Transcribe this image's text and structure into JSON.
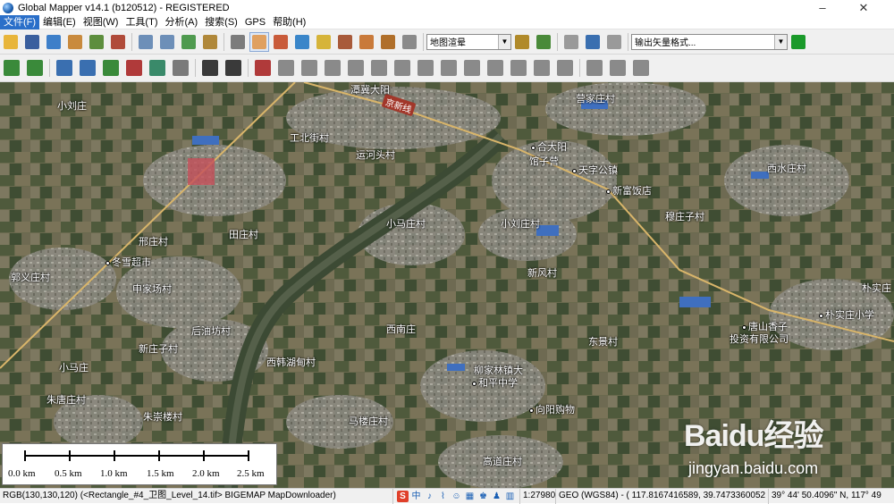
{
  "app": {
    "title": "Global Mapper v14.1 (b120512) - REGISTERED",
    "icon": "globe-icon"
  },
  "window_controls": {
    "minimize": "–",
    "close": "✕"
  },
  "menu": [
    {
      "label": "文件(F)",
      "active": true
    },
    {
      "label": "编辑(E)"
    },
    {
      "label": "视图(W)"
    },
    {
      "label": "工具(T)"
    },
    {
      "label": "分析(A)"
    },
    {
      "label": "搜索(S)"
    },
    {
      "label": "GPS"
    },
    {
      "label": "帮助(H)"
    }
  ],
  "toolbar1": {
    "buttons_a": [
      {
        "name": "open-folder-icon",
        "color": "#e8b53a"
      },
      {
        "name": "save-icon",
        "color": "#3a5f9e"
      },
      {
        "name": "globe-data-icon",
        "color": "#3d7fc9"
      },
      {
        "name": "image-icon",
        "color": "#c98a3d"
      },
      {
        "name": "layers-icon",
        "color": "#5d8e3d"
      },
      {
        "name": "config-tools-icon",
        "color": "#b04b3a"
      }
    ],
    "buttons_b": [
      {
        "name": "zoom-in-icon",
        "color": "#6d8fb8"
      },
      {
        "name": "zoom-out-icon",
        "color": "#6d8fb8"
      },
      {
        "name": "zoom-layer-icon",
        "color": "#4f9a4f"
      },
      {
        "name": "home-icon",
        "color": "#b0883a"
      }
    ],
    "buttons_c": [
      {
        "name": "select-tool-icon",
        "color": "#7c7c7c"
      },
      {
        "name": "pan-hand-icon",
        "color": "#e0a060",
        "pressed": true
      },
      {
        "name": "measure-icon",
        "color": "#c95b3a"
      },
      {
        "name": "info-icon",
        "color": "#3a86c9"
      },
      {
        "name": "digitizer-icon",
        "color": "#d6b43a"
      },
      {
        "name": "path-profile-icon",
        "color": "#a85a3a"
      },
      {
        "name": "edit-draw-icon",
        "color": "#c97a3a"
      },
      {
        "name": "feature-down-icon",
        "color": "#b06f2a"
      },
      {
        "name": "horseshoe-icon",
        "color": "#8a8a8a"
      }
    ],
    "theme_combo": {
      "value": "地图渲晕"
    },
    "buttons_d": [
      {
        "name": "shader-settings-icon",
        "color": "#b08a2a"
      },
      {
        "name": "lighting-icon",
        "color": "#4a8a3a"
      }
    ],
    "buttons_e": [
      {
        "name": "3d-view-icon",
        "color": "#9a9a9a"
      },
      {
        "name": "book-icon",
        "color": "#3a6fb0"
      },
      {
        "name": "star-icon",
        "color": "#9a9a9a"
      }
    ],
    "export_combo": {
      "value": "输出矢量格式..."
    },
    "run_button": {
      "name": "play-icon",
      "color": "#1a9a2a"
    }
  },
  "toolbar2": {
    "buttons": [
      {
        "name": "create-area-icon",
        "color": "#3a8a3a"
      },
      {
        "name": "create-line-icon",
        "color": "#3a8a3a"
      },
      {
        "name": "edit-vertices-icon",
        "color": "#3a6fb0"
      },
      {
        "name": "reshape-icon",
        "color": "#3a6fb0"
      },
      {
        "name": "split-icon",
        "color": "#3a8a3a"
      },
      {
        "name": "combine-icon",
        "color": "#b03a3a"
      },
      {
        "name": "rotate-feature-icon",
        "color": "#3a8a6a"
      },
      {
        "name": "grid-feature-icon",
        "color": "#7a7a7a"
      },
      {
        "name": "points-icon",
        "color": "#3a3a3a"
      },
      {
        "name": "line-arrow-icon",
        "color": "#3a3a3a"
      },
      {
        "name": "draw-pen-icon",
        "color": "#b03a3a"
      },
      {
        "name": "tool-a-icon",
        "color": "#8a8a8a"
      },
      {
        "name": "tool-b-icon",
        "color": "#8a8a8a"
      },
      {
        "name": "tool-c-icon",
        "color": "#8a8a8a"
      },
      {
        "name": "tool-d-icon",
        "color": "#8a8a8a"
      },
      {
        "name": "tool-e-icon",
        "color": "#8a8a8a"
      },
      {
        "name": "tool-f-icon",
        "color": "#8a8a8a"
      },
      {
        "name": "tool-g-icon",
        "color": "#8a8a8a"
      },
      {
        "name": "tool-h-icon",
        "color": "#8a8a8a"
      },
      {
        "name": "tool-i-icon",
        "color": "#8a8a8a"
      },
      {
        "name": "tool-j-icon",
        "color": "#8a8a8a"
      },
      {
        "name": "tool-k-icon",
        "color": "#8a8a8a"
      },
      {
        "name": "tool-l-icon",
        "color": "#8a8a8a"
      },
      {
        "name": "tool-m-icon",
        "color": "#8a8a8a"
      },
      {
        "name": "tool-n-icon",
        "color": "#8a8a8a"
      },
      {
        "name": "tool-o-icon",
        "color": "#8a8a8a"
      },
      {
        "name": "tool-p-icon",
        "color": "#8a8a8a"
      }
    ]
  },
  "map": {
    "road_label": "京新线",
    "places": [
      {
        "text": "小刘庄",
        "dot": false
      },
      {
        "text": "工北街村",
        "dot": false
      },
      {
        "text": "潭冀大阳",
        "dot": false
      },
      {
        "text": "运河头村",
        "dot": false
      },
      {
        "text": "合大阳",
        "dot": true
      },
      {
        "text": "营家庄村",
        "dot": false
      },
      {
        "text": "馆子营",
        "dot": false
      },
      {
        "text": "天字公镇",
        "dot": true
      },
      {
        "text": "西水庄村",
        "dot": false
      },
      {
        "text": "新富饭店",
        "dot": true
      },
      {
        "text": "小马庄村",
        "dot": false
      },
      {
        "text": "小刘庄村",
        "dot": false
      },
      {
        "text": "穆庄子村",
        "dot": false
      },
      {
        "text": "田庄村",
        "dot": false
      },
      {
        "text": "邢庄村",
        "dot": false
      },
      {
        "text": "冬雪超市",
        "dot": true
      },
      {
        "text": "新风村",
        "dot": false
      },
      {
        "text": "朴实庄",
        "dot": false
      },
      {
        "text": "郭义庄村",
        "dot": false
      },
      {
        "text": "申家场村",
        "dot": false
      },
      {
        "text": "唐山香子",
        "dot": true
      },
      {
        "text": "朴实庄小学",
        "dot": true
      },
      {
        "text": "后油坊村",
        "dot": false
      },
      {
        "text": "西南庄",
        "dot": false
      },
      {
        "text": "投资有限公司",
        "dot": false
      },
      {
        "text": "新庄子村",
        "dot": false
      },
      {
        "text": "东景村",
        "dot": false
      },
      {
        "text": "西韩湖甸村",
        "dot": false
      },
      {
        "text": "小马庄",
        "dot": false
      },
      {
        "text": "柳家林镇大",
        "dot": false
      },
      {
        "text": "和平中学",
        "dot": true
      },
      {
        "text": "朱唐庄村",
        "dot": false
      },
      {
        "text": "向阳购物",
        "dot": true
      },
      {
        "text": "朱崇楼村",
        "dot": false
      },
      {
        "text": "马楼庄村",
        "dot": false
      },
      {
        "text": "高道庄村",
        "dot": false
      }
    ],
    "scalebar": [
      "0.0 km",
      "0.5 km",
      "1.0 km",
      "1.5 km",
      "2.0 km",
      "2.5 km"
    ]
  },
  "watermark": {
    "brand": "Baidu经验",
    "url": "jingyan.baidu.com"
  },
  "statusbar": {
    "cell1": "RGB(130,130,120) (<Rectangle_#4_卫图_Level_14.tif> BIGEMAP MapDownloader)",
    "ime": [
      "S",
      "中",
      "♪",
      "⌇",
      "☺",
      "▦",
      "♚",
      "♟",
      "▥"
    ],
    "scale": "1:27980",
    "geo": "GEO (WGS84) - ( 117.8167416589, 39.7473360052 )",
    "dms": "39° 44' 50.4096\" N, 117° 49"
  }
}
